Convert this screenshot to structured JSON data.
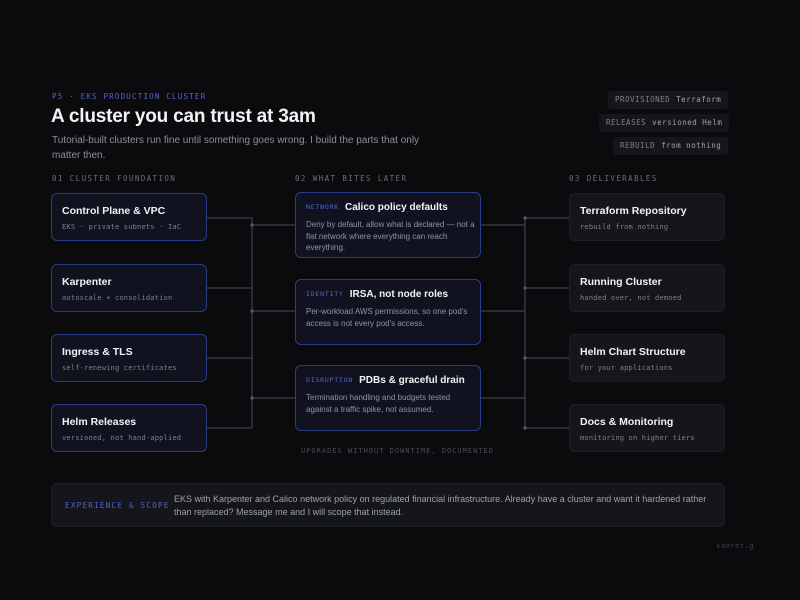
{
  "header": {
    "eyebrow": "P5 · EKS PRODUCTION CLUSTER",
    "title": "A cluster you can trust at 3am",
    "subtitle": "Tutorial-built clusters run fine until something goes wrong. I build the parts that only matter then."
  },
  "tags": [
    {
      "key": "PROVISIONED",
      "value": "Terraform"
    },
    {
      "key": "RELEASES",
      "value": "versioned Helm"
    },
    {
      "key": "REBUILD",
      "value": "from nothing"
    }
  ],
  "columns": {
    "foundation": {
      "heading": "01  CLUSTER FOUNDATION",
      "items": [
        {
          "title": "Control Plane & VPC",
          "sub": "EKS · private subnets · IaC"
        },
        {
          "title": "Karpenter",
          "sub": "autoscale + consolidation"
        },
        {
          "title": "Ingress & TLS",
          "sub": "self-renewing certificates"
        },
        {
          "title": "Helm Releases",
          "sub": "versioned, not hand-applied"
        }
      ]
    },
    "risks": {
      "heading": "02  WHAT BITES LATER",
      "items": [
        {
          "tag": "NETWORK",
          "title": "Calico policy defaults",
          "body": "Deny by default, allow what is declared — not a flat network where everything can reach everything."
        },
        {
          "tag": "IDENTITY",
          "title": "IRSA, not node roles",
          "body": "Per-workload AWS permissions, so one pod's access is not every pod's access."
        },
        {
          "tag": "DISRUPTION",
          "title": "PDBs & graceful drain",
          "body": "Termination handling and budgets tested against a traffic spike, not assumed."
        }
      ],
      "footnote": "UPGRADES WITHOUT DOWNTIME, DOCUMENTED"
    },
    "deliverables": {
      "heading": "03  DELIVERABLES",
      "items": [
        {
          "title": "Terraform Repository",
          "sub": "rebuild from nothing"
        },
        {
          "title": "Running Cluster",
          "sub": "handed over, not demoed"
        },
        {
          "title": "Helm Chart Structure",
          "sub": "for your applications"
        },
        {
          "title": "Docs & Monitoring",
          "sub": "monitoring on higher tiers"
        }
      ]
    }
  },
  "scope": {
    "label": "EXPERIENCE & SCOPE",
    "text": "EKS with Karpenter and Calico network policy on regulated financial infrastructure. Already have a cluster and want it hardened rather than replaced? Message me and I will scope that instead."
  },
  "signature": "sanret.g",
  "colors": {
    "background": "#0b0b0e",
    "accent": "#4f63d8",
    "card_border_blue": "#2c3b85",
    "connector": "#4a4c55"
  }
}
